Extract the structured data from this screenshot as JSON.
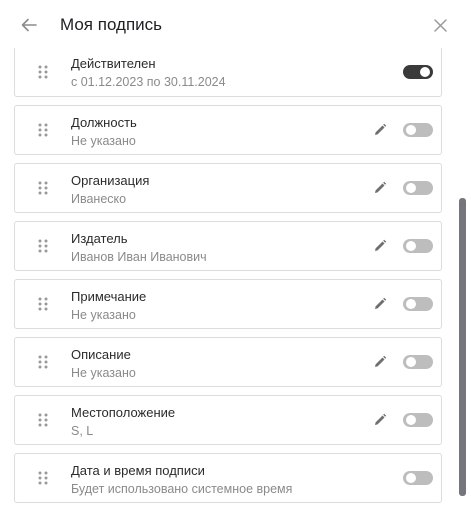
{
  "header": {
    "title": "Моя подпись",
    "back_icon": "arrow-left-icon",
    "close_icon": "close-icon"
  },
  "colors": {
    "toggle_on": "#3a3a3a",
    "toggle_off": "#bdbdbd",
    "scrollbar": "#74767c"
  },
  "items": [
    {
      "label": "Действителен",
      "sub": "с 01.12.2023 по 30.11.2024",
      "editable": false,
      "enabled": true
    },
    {
      "label": "Должность",
      "sub": "Не указано",
      "editable": true,
      "enabled": false
    },
    {
      "label": "Организация",
      "sub": "Иванеско",
      "editable": true,
      "enabled": false
    },
    {
      "label": "Издатель",
      "sub": "Иванов Иван Иванович",
      "editable": true,
      "enabled": false
    },
    {
      "label": "Примечание",
      "sub": "Не указано",
      "editable": true,
      "enabled": false
    },
    {
      "label": "Описание",
      "sub": "Не указано",
      "editable": true,
      "enabled": false
    },
    {
      "label": "Местоположение",
      "sub": "S, L",
      "editable": true,
      "enabled": false
    },
    {
      "label": "Дата и время подписи",
      "sub": "Будет использовано системное время",
      "editable": false,
      "enabled": false
    }
  ]
}
